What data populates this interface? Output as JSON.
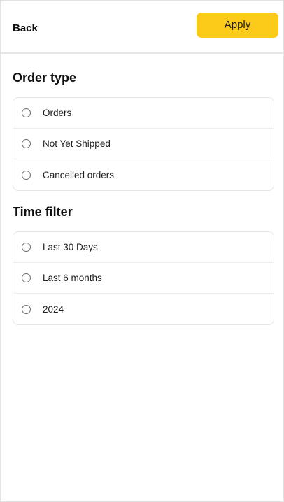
{
  "header": {
    "back_label": "Back",
    "apply_label": "Apply"
  },
  "order_type": {
    "title": "Order type",
    "options": [
      {
        "label": "Orders",
        "selected": false
      },
      {
        "label": "Not Yet Shipped",
        "selected": false
      },
      {
        "label": "Cancelled orders",
        "selected": false
      }
    ]
  },
  "time_filter": {
    "title": "Time filter",
    "options": [
      {
        "label": "Last 30 Days",
        "selected": false
      },
      {
        "label": "Last 6 months",
        "selected": false
      },
      {
        "label": "2024",
        "selected": false
      }
    ]
  },
  "colors": {
    "accent": "#fccb1a"
  }
}
